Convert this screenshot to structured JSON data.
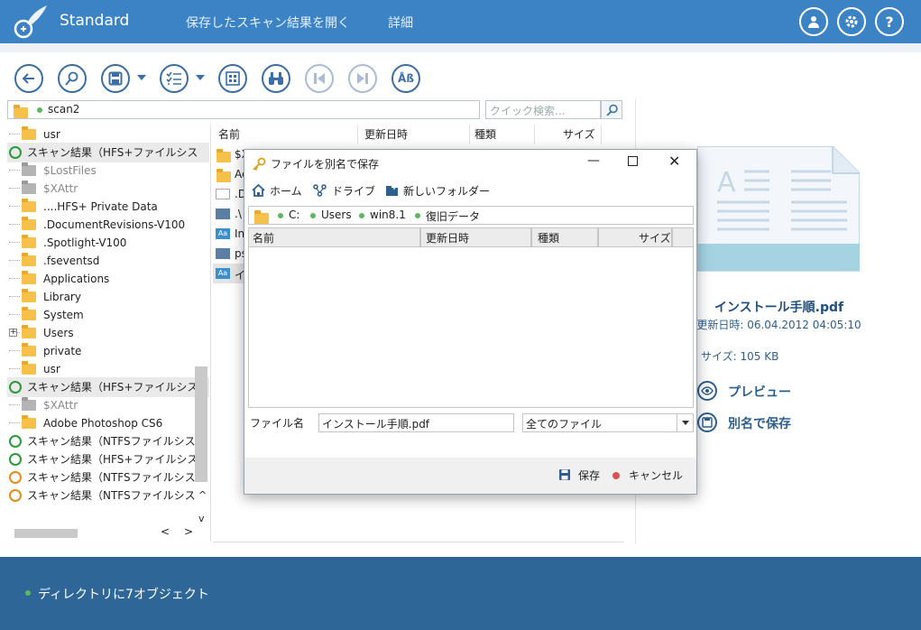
{
  "header": {
    "app_name": "Standard",
    "menu": [
      "保存したスキャン結果を開く",
      "詳細"
    ]
  },
  "toolbar": {
    "buttons": [
      "back-icon",
      "search-icon",
      "save-icon",
      "list-icon",
      "grid-icon",
      "binoculars-icon",
      "prev-icon",
      "next-icon",
      "font-icon"
    ],
    "font_label": "Åß"
  },
  "address": {
    "path": "scan2",
    "search_placeholder": "クイック検索..."
  },
  "tree": {
    "items": [
      {
        "label": "usr",
        "kind": "folder"
      },
      {
        "label": "スキャン結果（HFS+ファイルシス",
        "kind": "scan"
      },
      {
        "label": "$LostFiles",
        "kind": "grey"
      },
      {
        "label": "$XAttr",
        "kind": "grey"
      },
      {
        "label": "....HFS+ Private Data",
        "kind": "folder"
      },
      {
        "label": ".DocumentRevisions-V100",
        "kind": "folder"
      },
      {
        "label": ".Spotlight-V100",
        "kind": "folder"
      },
      {
        "label": ".fseventsd",
        "kind": "folder"
      },
      {
        "label": "Applications",
        "kind": "folder"
      },
      {
        "label": "Library",
        "kind": "folder"
      },
      {
        "label": "System",
        "kind": "folder"
      },
      {
        "label": "Users",
        "kind": "folder-expand"
      },
      {
        "label": "private",
        "kind": "folder"
      },
      {
        "label": "usr",
        "kind": "folder"
      },
      {
        "label": "スキャン結果（HFS+ファイルシス",
        "kind": "scan"
      },
      {
        "label": "$XAttr",
        "kind": "grey"
      },
      {
        "label": "Adobe Photoshop CS6",
        "kind": "folder"
      },
      {
        "label": "スキャン結果（NTFSファイルシス",
        "kind": "scan"
      },
      {
        "label": "スキャン結果（HFS+ファイルシス",
        "kind": "scan"
      },
      {
        "label": "スキャン結果（NTFSファイルシス",
        "kind": "scan-orange"
      },
      {
        "label": "スキャン結果（NTFSファイルシス",
        "kind": "scan-orange"
      }
    ]
  },
  "list": {
    "columns": [
      "名前",
      "更新日時",
      "種類",
      "サイズ"
    ],
    "rows": [
      {
        "name": "$X",
        "icon": "folder"
      },
      {
        "name": "Ac",
        "icon": "folder"
      },
      {
        "name": ".D",
        "icon": "blank"
      },
      {
        "name": ".\\",
        "icon": "image"
      },
      {
        "name": "In",
        "icon": "font"
      },
      {
        "name": "ps",
        "icon": "image"
      },
      {
        "name": "イ",
        "icon": "font"
      }
    ]
  },
  "preview": {
    "filename": "インストール手順.pdf",
    "modified": "更新日時: 06.04.2012 04:05:10",
    "size": "サイズ: 105 KB",
    "preview_label": "プレビュー",
    "save_as_label": "別名で保存"
  },
  "status": {
    "text": "ディレクトリに7オブジェクト"
  },
  "dialog": {
    "title": "ファイルを別名で保存",
    "nav": {
      "home": "ホーム",
      "drive": "ドライブ",
      "new_folder": "新しいフォルダー"
    },
    "path": [
      "C:",
      "Users",
      "win8.1",
      "復旧データ"
    ],
    "columns": [
      "名前",
      "更新日時",
      "種類",
      "サイズ"
    ],
    "filename_label": "ファイル名",
    "filename_value": "インストール手順.pdf",
    "filetype_value": "全てのファイル",
    "save_label": "保存",
    "cancel_label": "キャンセル"
  }
}
